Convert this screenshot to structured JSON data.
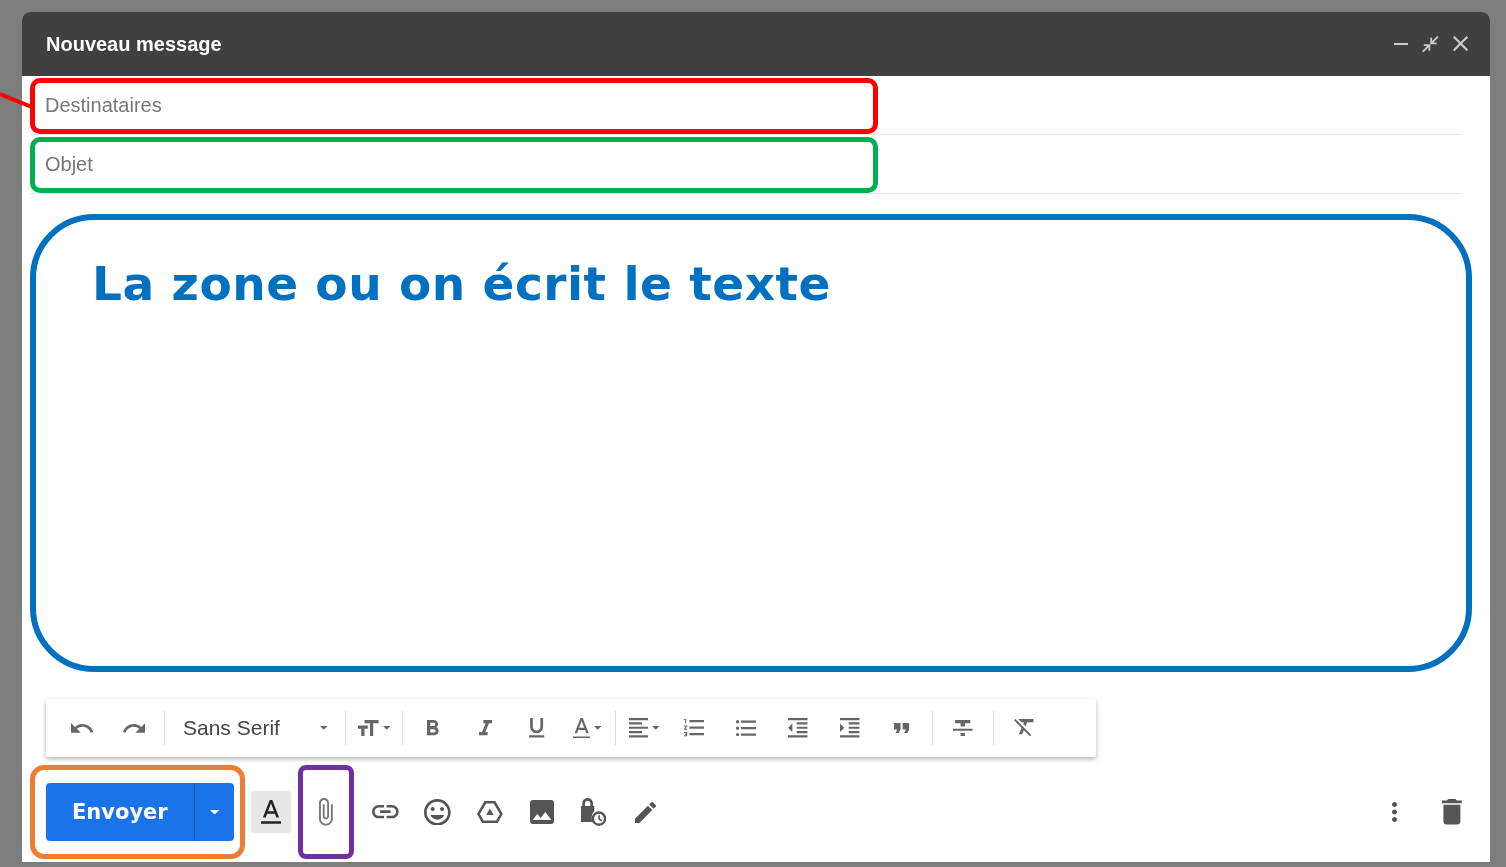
{
  "window": {
    "title": "Nouveau message"
  },
  "fields": [
    {
      "placeholder": "Destinataires",
      "color": "#ff0000"
    },
    {
      "placeholder": "Objet",
      "color": "#00b050"
    }
  ],
  "body": {
    "annotation": "La zone ou on écrit le texte"
  },
  "format_toolbar": {
    "font": "Sans Serif"
  },
  "send_button": {
    "label": "Envoyer"
  }
}
